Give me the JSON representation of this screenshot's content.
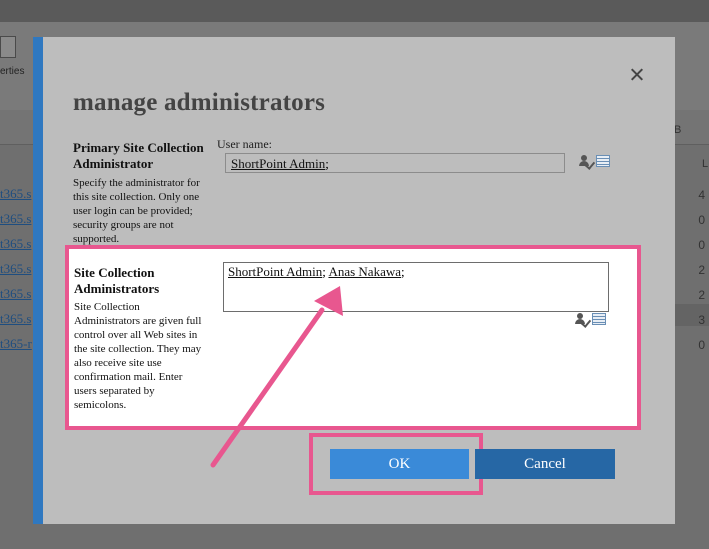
{
  "background": {
    "toolbar_label": "erties",
    "left_links": [
      "t365.s",
      "t365.s",
      "t365.s",
      "t365.s",
      "t365.s",
      "t365.s",
      "t365-r"
    ],
    "right_values": [
      "4",
      "0",
      "0",
      "2",
      "2",
      "3",
      "0"
    ],
    "right_header_b": "B",
    "right_header_l": "L"
  },
  "dialog": {
    "title": "manage administrators",
    "primary": {
      "heading_line1": "Primary Site Collection",
      "heading_line2": "Administrator",
      "desc_lines": [
        "Specify the administrator for",
        "this site collection. Only one",
        "user login can be provided;",
        "security groups are not",
        "supported."
      ],
      "field_label": "User name:",
      "value": "ShortPoint Admin",
      "separator": ";"
    },
    "admins": {
      "heading_line1": "Site Collection",
      "heading_line2": "Administrators",
      "desc_lines": [
        "Site Collection",
        "Administrators are given full",
        "control over all Web sites in",
        "the site collection. They may",
        "also receive site use",
        "confirmation mail. Enter",
        "users separated by",
        "semicolons."
      ],
      "users": [
        "ShortPoint Admin",
        "Anas Nakawa"
      ],
      "separator": ";"
    },
    "buttons": {
      "ok": "OK",
      "cancel": "Cancel"
    }
  },
  "colors": {
    "annotation": "#e8578f",
    "ok_button": "#3a8ad8",
    "cancel_button": "#2667a5",
    "dialog_accent": "#2f78c0"
  }
}
